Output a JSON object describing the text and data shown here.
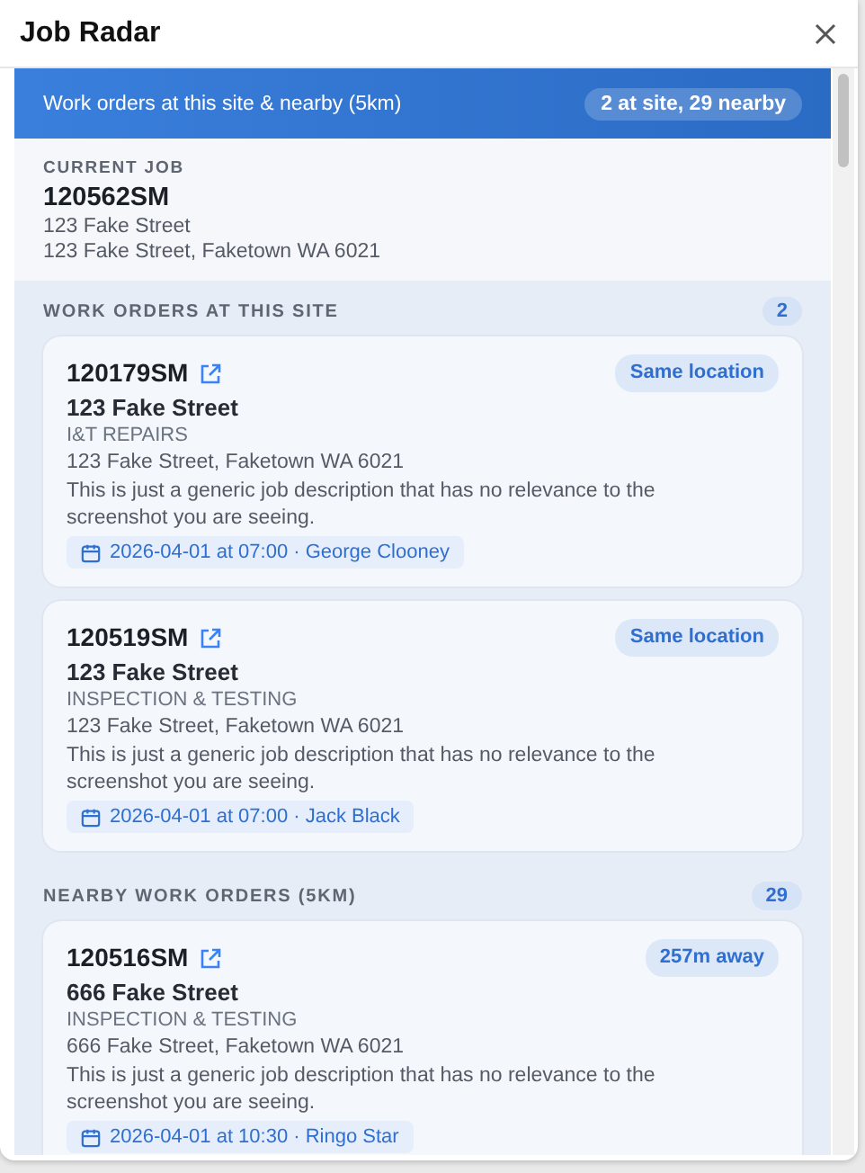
{
  "window": {
    "title": "Job Radar"
  },
  "banner": {
    "text": "Work orders at this site & nearby (5km)",
    "summary": "2 at site, 29 nearby"
  },
  "current_job": {
    "label": "CURRENT JOB",
    "number": "120562SM",
    "street": "123 Fake Street",
    "address": "123 Fake Street, Faketown WA 6021"
  },
  "sections": [
    {
      "title": "WORK ORDERS AT THIS SITE",
      "count": "2",
      "orders": [
        {
          "number": "120179SM",
          "badge": "Same location",
          "street": "123 Fake Street",
          "type": "I&T REPAIRS",
          "address": "123 Fake Street, Faketown WA 6021",
          "description": "This is just a generic job description that has no relevance to the screenshot you are seeing.",
          "schedule": "2026-04-01 at 07:00 · George Clooney"
        },
        {
          "number": "120519SM",
          "badge": "Same location",
          "street": "123 Fake Street",
          "type": "INSPECTION & TESTING",
          "address": "123 Fake Street, Faketown WA 6021",
          "description": "This is just a generic job description that has no relevance to the screenshot you are seeing.",
          "schedule": "2026-04-01 at 07:00 · Jack Black"
        }
      ]
    },
    {
      "title": "NEARBY WORK ORDERS (5KM)",
      "count": "29",
      "orders": [
        {
          "number": "120516SM",
          "badge": "257m away",
          "street": "666 Fake Street",
          "type": "INSPECTION & TESTING",
          "address": "666 Fake Street, Faketown WA 6021",
          "description": "This is just a generic job description that has no relevance to the screenshot you are seeing.",
          "schedule": "2026-04-01 at 10:30 · Ringo Star"
        }
      ]
    }
  ]
}
